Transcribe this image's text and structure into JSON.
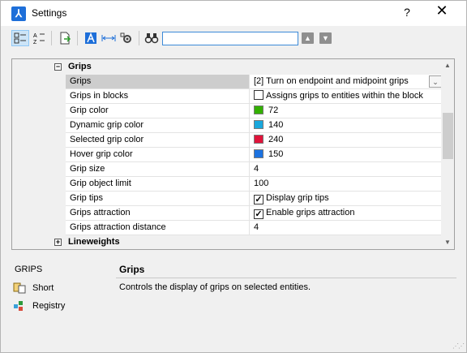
{
  "window": {
    "title": "Settings",
    "help_label": "?",
    "close_label": "✕"
  },
  "toolbar": {
    "search_value": "",
    "icons": [
      "categorized-view-icon",
      "alphabetical-view-icon",
      "export-icon",
      "app-logo-icon",
      "dimension-icon",
      "gear-settings-icon",
      "find-binoculars-icon",
      "arrow-up-icon",
      "arrow-down-icon"
    ]
  },
  "grid": {
    "section_grips": "Grips",
    "section_lineweights": "Lineweights",
    "rows": [
      {
        "name": "Grips",
        "value": "[2] Turn on endpoint and midpoint grips",
        "type": "dropdown"
      },
      {
        "name": "Grips in blocks",
        "value": "Assigns grips to entities within the block",
        "type": "checkbox",
        "checked": false
      },
      {
        "name": "Grip color",
        "value": "72",
        "type": "color",
        "color": "#33b000"
      },
      {
        "name": "Dynamic grip color",
        "value": "140",
        "type": "color",
        "color": "#19a7dc"
      },
      {
        "name": "Selected grip color",
        "value": "240",
        "type": "color",
        "color": "#e0133a"
      },
      {
        "name": "Hover grip color",
        "value": "150",
        "type": "color",
        "color": "#1c72e0"
      },
      {
        "name": "Grip size",
        "value": "4",
        "type": "text"
      },
      {
        "name": "Grip object limit",
        "value": "100",
        "type": "text"
      },
      {
        "name": "Grip tips",
        "value": "Display grip tips",
        "type": "checkbox",
        "checked": true
      },
      {
        "name": "Grips attraction",
        "value": "Enable grips attraction",
        "type": "checkbox",
        "checked": true
      },
      {
        "name": "Grips attraction distance",
        "value": "4",
        "type": "text"
      }
    ]
  },
  "description": {
    "key": "GRIPS",
    "title": "Grips",
    "text": "Controls the display of grips on selected entities.",
    "side_items": [
      {
        "label": "Short",
        "icon": "short-icon"
      },
      {
        "label": "Registry",
        "icon": "registry-icon"
      }
    ]
  }
}
